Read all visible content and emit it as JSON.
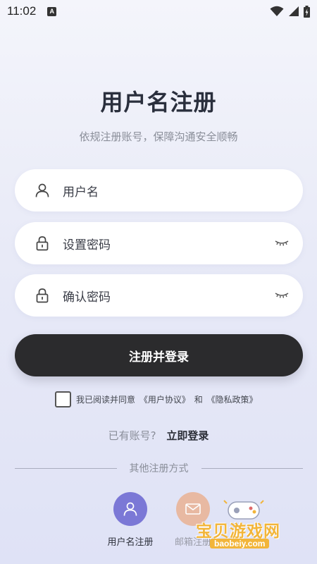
{
  "status_bar": {
    "time": "11:02",
    "notification_letter": "A"
  },
  "header": {
    "title": "用户名注册",
    "subtitle": "依规注册账号，保障沟通安全顺畅"
  },
  "form": {
    "username_label": "用户名",
    "password_label": "设置密码",
    "confirm_label": "确认密码"
  },
  "submit_label": "注册并登录",
  "agreement": {
    "prefix": "我已阅读并同意",
    "user_agreement": "《用户协议》",
    "and": "和",
    "privacy_policy": "《隐私政策》",
    "checked": false
  },
  "login_prompt": {
    "question": "已有账号?",
    "link": "立即登录"
  },
  "alt_methods": {
    "divider_text": "其他注册方式",
    "items": [
      {
        "label": "用户名注册",
        "icon": "user-icon",
        "color": "#7b78d6"
      },
      {
        "label": "邮箱注册",
        "icon": "mail-icon",
        "color": "#e8b9a2"
      }
    ]
  },
  "watermark": {
    "text": "宝贝游戏网",
    "url": "baobeiy.com"
  },
  "colors": {
    "primary_dark": "#2b2b2d",
    "accent_purple": "#7b78d6",
    "accent_peach": "#e8b9a2"
  }
}
